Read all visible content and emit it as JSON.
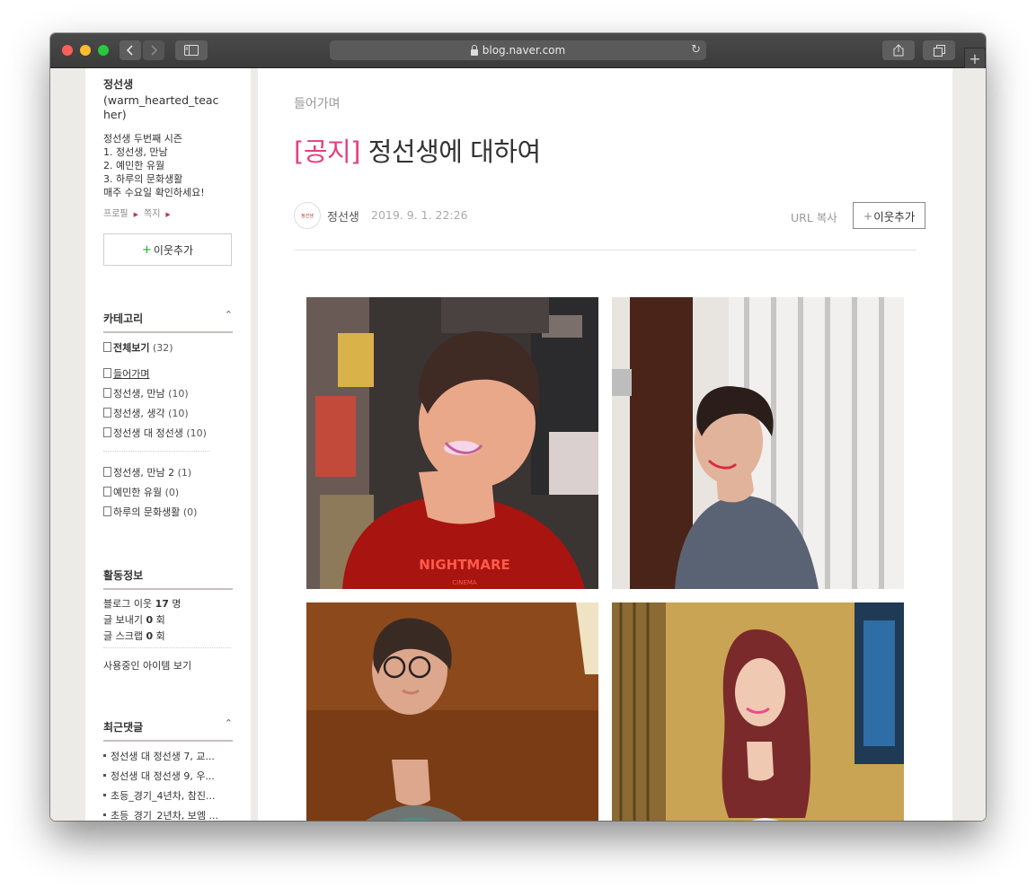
{
  "browser": {
    "url": "blog.naver.com",
    "new_tab_label": "+"
  },
  "sidebar": {
    "blogger_name": "정선생",
    "blogger_id": "(warm_hearted_teacher)",
    "intro_lines": [
      "정선생 두번째 시즌",
      "1. 정선생, 만남",
      "2. 예민한 유월",
      "3. 하루의 문화생활",
      "매주 수요일 확인하세요!"
    ],
    "links": [
      "프로필",
      "쪽지"
    ],
    "add_neighbor_button": {
      "plus": "+",
      "label": "이웃추가"
    },
    "category_title": "카테고리",
    "categories": [
      {
        "label": "전체보기",
        "count": "(32)"
      },
      {
        "label": "들어가며",
        "count": ""
      },
      {
        "label": "정선생, 만남",
        "count": "(10)"
      },
      {
        "label": "정선생, 생각",
        "count": "(10)"
      },
      {
        "label": "정선생 대 정선생",
        "count": "(10)"
      },
      {
        "label": "정선생, 만남 2",
        "count": "(1)"
      },
      {
        "label": "예민한 유월",
        "count": "(0)"
      },
      {
        "label": "하루의 문화생활",
        "count": "(0)"
      }
    ],
    "activity_title": "활동정보",
    "activity": [
      {
        "prefix": "블로그 이웃",
        "value": "17",
        "suffix": "명"
      },
      {
        "prefix": "글 보내기",
        "value": "0",
        "suffix": "회"
      },
      {
        "prefix": "글 스크랩",
        "value": "0",
        "suffix": "회"
      }
    ],
    "items_link": "사용중인 아이템 보기",
    "recent_title": "최근댓글",
    "recent_comments": [
      "정선생 대 정선생 7, 교...",
      "정선생 대 정선생 9, 우...",
      "초등_경기_4년차, 참진...",
      "초등_경기_2년차, 보엠 ..."
    ]
  },
  "post": {
    "category": "들어가며",
    "title_tag": "[공지]",
    "title_text": "정선생에 대하여",
    "avatar_text": "정선생",
    "author": "정선생",
    "date": "2019. 9. 1. 22:26",
    "url_copy": "URL 복사",
    "neighbor_button": {
      "plus": "+",
      "label": "이웃추가"
    },
    "photo_text": "NIGHTMARE",
    "photo_subtext": "CINEMA"
  },
  "colors": {
    "accent_pink": "#e3407f",
    "add_plus_green": "#19b12c",
    "section_underline": "#c8bfbf",
    "page_background": "#ecebe8"
  }
}
